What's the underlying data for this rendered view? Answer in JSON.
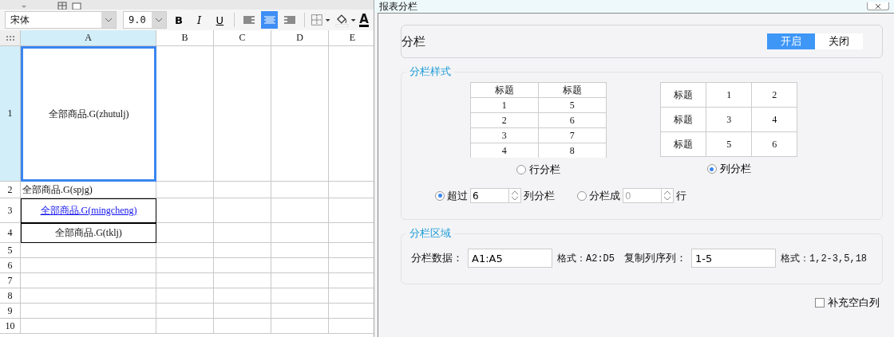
{
  "toolbar": {
    "font": "宋体",
    "size": "9.0",
    "format_buttons": [
      {
        "kind": "bold",
        "label": "B"
      },
      {
        "kind": "italic",
        "label": "I"
      },
      {
        "kind": "underline",
        "label": "U"
      }
    ],
    "align_buttons": [
      {
        "kind": "left",
        "selected": false
      },
      {
        "kind": "center",
        "selected": true
      },
      {
        "kind": "right",
        "selected": false
      }
    ],
    "font_color_label": "A"
  },
  "sheet": {
    "columns": [
      {
        "label": "A",
        "selected": true
      },
      {
        "label": "B",
        "selected": false
      },
      {
        "label": "C",
        "selected": false
      },
      {
        "label": "D",
        "selected": false
      },
      {
        "label": "E",
        "selected": false
      }
    ],
    "rows": [
      {
        "number": "1",
        "selected": true,
        "kind": "selected",
        "cell": "全部商品.G(zhutulj)"
      },
      {
        "number": "2",
        "selected": false,
        "kind": "plain",
        "cell": "全部商品.G(spjg)"
      },
      {
        "number": "3",
        "selected": false,
        "kind": "link",
        "cell": "全部商品.G(mingcheng)"
      },
      {
        "number": "4",
        "selected": false,
        "kind": "boxed",
        "cell": "全部商品.G(tklj)"
      },
      {
        "number": "5",
        "selected": false
      },
      {
        "number": "6",
        "selected": false
      },
      {
        "number": "7",
        "selected": false
      },
      {
        "number": "8",
        "selected": false
      },
      {
        "number": "9",
        "selected": false
      },
      {
        "number": "10",
        "selected": false
      }
    ]
  },
  "dialog": {
    "title": "报表分栏",
    "switch": {
      "label": "分栏",
      "options": [
        {
          "label": "开启",
          "selected": true
        },
        {
          "label": "关闭",
          "selected": false
        }
      ]
    },
    "style_group": {
      "title": "分栏样式",
      "row_preview": {
        "header": [
          "标题",
          "标题"
        ],
        "rows": [
          [
            "1",
            "5"
          ],
          [
            "2",
            "6"
          ],
          [
            "3",
            "7"
          ],
          [
            "4",
            "8"
          ]
        ]
      },
      "row_option": {
        "label": "行分栏",
        "selected": false
      },
      "column_preview": {
        "rows": [
          [
            "标题",
            "1",
            "2"
          ],
          [
            "标题",
            "3",
            "4"
          ],
          [
            "标题",
            "5",
            "6"
          ]
        ]
      },
      "column_option": {
        "label": "列分栏",
        "selected": true
      },
      "exceed": {
        "selected": true,
        "disabled": false,
        "prefix": "超过",
        "value": "6",
        "suffix": "列分栏"
      },
      "split": {
        "selected": false,
        "disabled": true,
        "prefix": "分栏成",
        "value": "0",
        "suffix": "行"
      }
    },
    "area_group": {
      "title": "分栏区域",
      "data_label": "分栏数据：",
      "data_value": "A1:A5",
      "data_hint": "格式：A2:D5",
      "copy_label": "复制列序列：",
      "copy_value": "1-5",
      "copy_hint": "格式：1,2-3,5,18"
    },
    "fill_blank": {
      "label": "补充空白列",
      "checked": false
    }
  }
}
